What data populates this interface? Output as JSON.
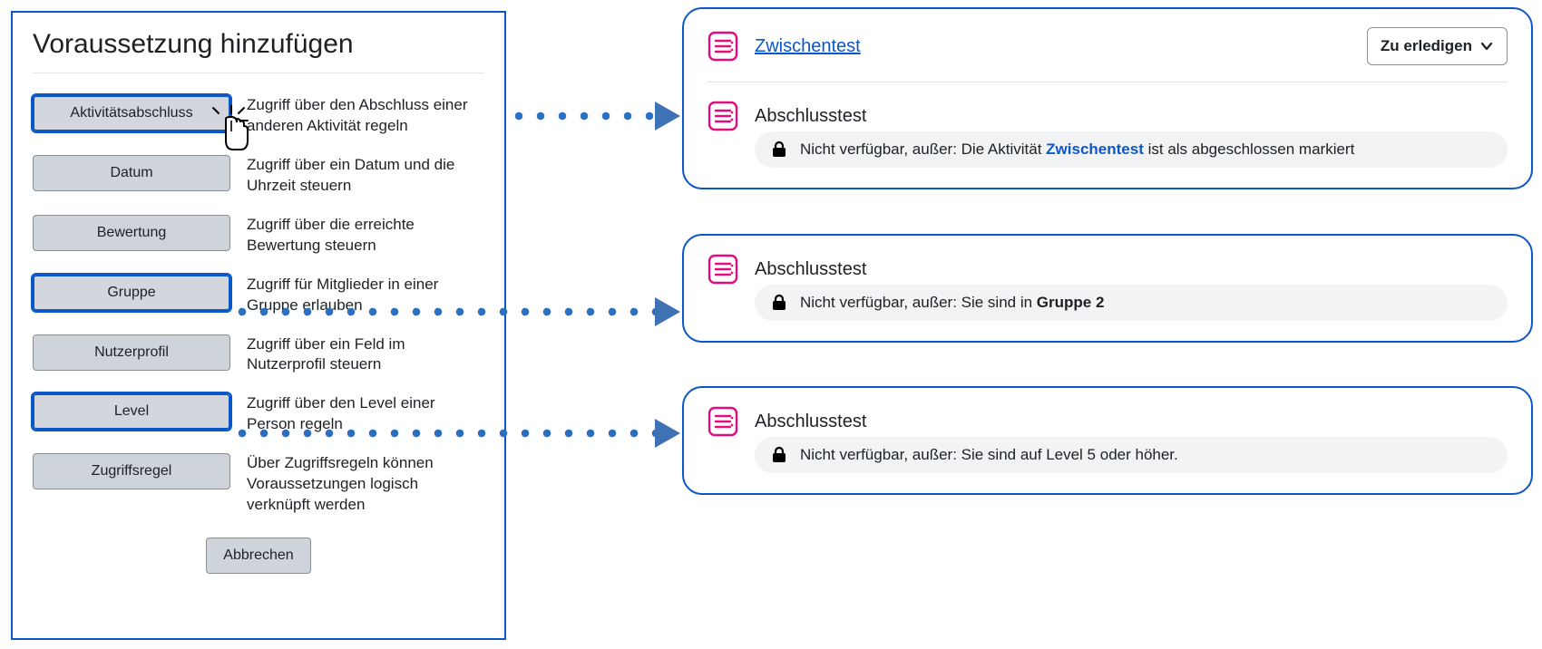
{
  "dialog": {
    "title": "Voraussetzung hinzufügen",
    "options": [
      {
        "id": "activity-completion",
        "label": "Aktivitätsabschluss",
        "desc": "Zugriff über den Abschluss einer anderen Aktivität regeln",
        "highlight": true,
        "clicking": true
      },
      {
        "id": "date",
        "label": "Datum",
        "desc": "Zugriff über ein Datum und die Uhrzeit steuern"
      },
      {
        "id": "grade",
        "label": "Bewertung",
        "desc": "Zugriff über die erreichte Bewertung steuern"
      },
      {
        "id": "group",
        "label": "Gruppe",
        "desc": "Zugriff für Mitglieder in einer Gruppe erlauben",
        "highlight": true
      },
      {
        "id": "userprofile",
        "label": "Nutzerprofil",
        "desc": "Zugriff über ein Feld im Nutzerprofil steuern"
      },
      {
        "id": "level",
        "label": "Level",
        "desc": "Zugriff über den Level einer Person regeln",
        "highlight": true
      },
      {
        "id": "ruleset",
        "label": "Zugriffsregel",
        "desc": "Über Zugriffsregeln können Voraussetzungen logisch verknüpft werden"
      }
    ],
    "cancel": "Abbrechen"
  },
  "cards": [
    {
      "id": "card-activity",
      "items": [
        {
          "name": "Zwischentest",
          "link": true,
          "todo": "Zu erledigen"
        },
        "---",
        {
          "name": "Abschlusstest",
          "restriction": {
            "prefix": "Nicht verfügbar, außer: Die Aktivität ",
            "bold": "Zwischentest",
            "boldLink": true,
            "suffix": " ist als abgeschlossen markiert"
          }
        }
      ]
    },
    {
      "id": "card-group",
      "items": [
        {
          "name": "Abschlusstest",
          "restriction": {
            "prefix": "Nicht verfügbar, außer: Sie sind in ",
            "bold": "Gruppe 2",
            "suffix": ""
          }
        }
      ]
    },
    {
      "id": "card-level",
      "items": [
        {
          "name": "Abschlusstest",
          "restriction": {
            "prefix": "Nicht verfügbar, außer: Sie sind auf Level 5 oder höher.",
            "bold": "",
            "suffix": ""
          }
        }
      ]
    }
  ]
}
